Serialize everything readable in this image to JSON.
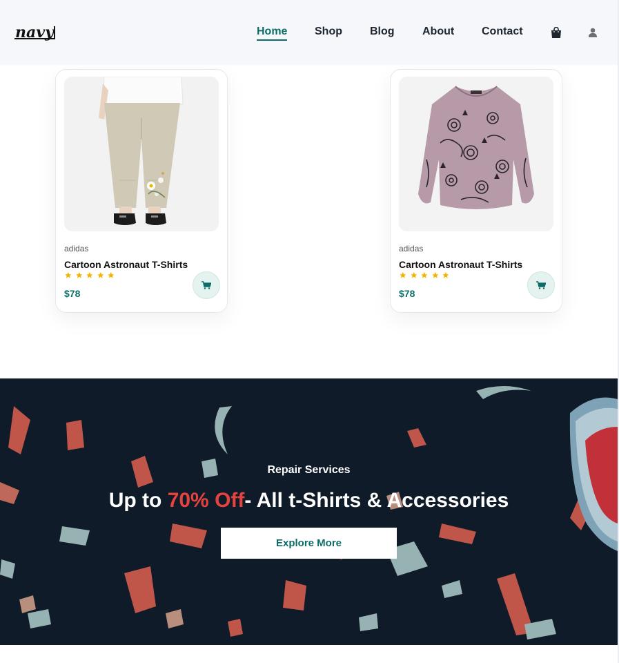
{
  "header": {
    "logo_text": "navy",
    "nav": [
      {
        "label": "Home",
        "active": true
      },
      {
        "label": "Shop",
        "active": false
      },
      {
        "label": "Blog",
        "active": false
      },
      {
        "label": "About",
        "active": false
      },
      {
        "label": "Contact",
        "active": false
      }
    ],
    "icons": [
      "shopping-bag-icon",
      "user-icon"
    ]
  },
  "products": [
    {
      "brand": "adidas",
      "title": "Cartoon Astronaut T-Shirts",
      "rating": 5,
      "price": "$78",
      "image": "linen-pants-photo"
    },
    {
      "brand": "adidas",
      "title": "Cartoon Astronaut T-Shirts",
      "rating": 5,
      "price": "$78",
      "image": "cat-print-blouse-photo"
    }
  ],
  "banner": {
    "subtitle": "Repair Services",
    "headline_prefix": "Up to ",
    "headline_highlight": "70% Off",
    "headline_suffix": "- All t-Shirts & Accessories",
    "button_label": "Explore More"
  },
  "colors": {
    "accent": "#0c6d68",
    "highlight": "#e5433f",
    "banner_bg": "#0f1b28",
    "star": "#f4b400"
  }
}
